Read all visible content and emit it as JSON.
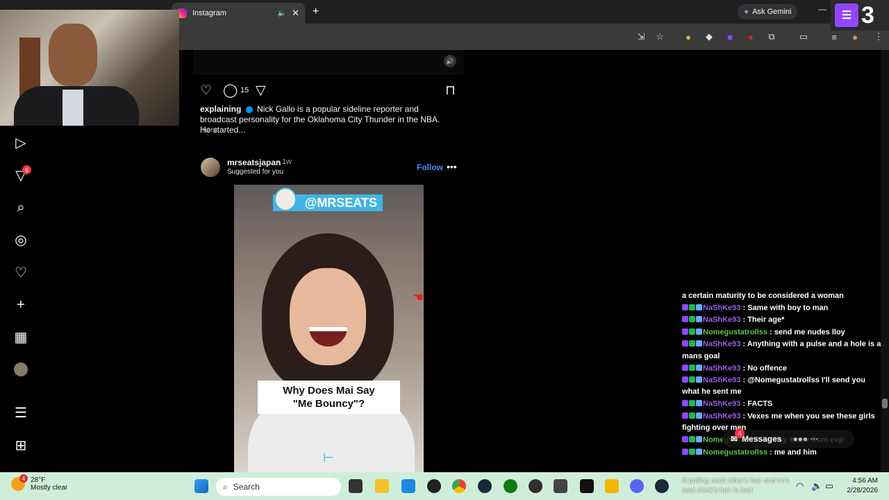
{
  "browser": {
    "active_tab": {
      "title": "Instagram"
    },
    "toolbar_right": {
      "gemini_label": "Ask Gemini"
    }
  },
  "twitch_overlay": {
    "viewer_count": "3"
  },
  "instagram": {
    "nav": {
      "notifications_count": "6"
    },
    "previous_post": {
      "comments_count": "15",
      "caption_user": "explaining",
      "caption_text": "Nick Gallo is a popular sideline reporter and broadcast personality for the Oklahoma City Thunder in the NBA. He started...",
      "more_label": "more"
    },
    "post": {
      "username": "mrseatsjapan",
      "time": "• 1w",
      "subtitle": "Suggested for you",
      "follow_label": "Follow",
      "video_handle": "@MRSEATS",
      "overlay_caption_line1": "Why Does Mai Say",
      "overlay_caption_line2": "\"Me Bouncy\"?"
    },
    "messages": {
      "label": "Messages",
      "badge": "4"
    }
  },
  "chat": {
    "lines": [
      {
        "user": "",
        "text": "a certain maturity to be considered a woman",
        "color": "none"
      },
      {
        "user": "NaShKe93",
        "text": ": Same with boy to man",
        "color": "purple"
      },
      {
        "user": "NaShKe93",
        "text": ": Their age*",
        "color": "purple"
      },
      {
        "user": "Nomegustatrollss",
        "text": ": send me nudes lloy",
        "color": "green"
      },
      {
        "user": "NaShKe93",
        "text": ": Anything with a pulse and a hole is a mans goal",
        "color": "purple"
      },
      {
        "user": "NaShKe93",
        "text": ": No offence",
        "color": "purple"
      },
      {
        "user": "NaShKe93",
        "text": ": @Nomegustatrollss I'll send you what he sent me",
        "color": "purple"
      },
      {
        "user": "NaShKe93",
        "text": ": FACTS",
        "color": "purple"
      },
      {
        "user": "NaShKe93",
        "text": ": Vexes me when you see these girls fighting over men",
        "color": "purple"
      },
      {
        "user": "Nomegustatrollss",
        "text": ": lloy know from exp",
        "color": "green"
      },
      {
        "user": "Nomegustatrollss",
        "text": ": me and him",
        "color": "green"
      }
    ]
  },
  "taskbar": {
    "weather_temp": "28°F",
    "weather_desc": "Mostly clear",
    "weather_badge": "4",
    "search_placeholder": "Search",
    "tray_text_line1": "ill pulling each other's hair and he's",
    "tray_text_line2": "next chick's hair in bed",
    "time": "4:56 AM",
    "date": "2/28/2026"
  },
  "colors": {
    "accent_blue": "#4a8cff",
    "twitch_purple": "#9146ff",
    "chat_purple": "#9b5de5",
    "chat_green": "#5ec545",
    "taskbar_bg": "#cfeeda"
  }
}
